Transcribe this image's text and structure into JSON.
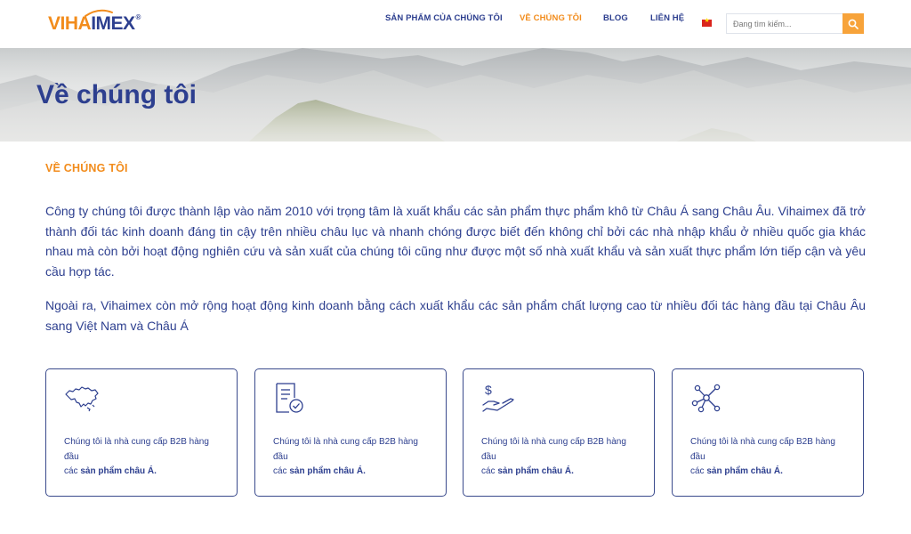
{
  "header": {
    "logo": {
      "part1": "VIHA",
      "part2": "IMEX",
      "reg": "®"
    },
    "nav": [
      {
        "label": "SẢN PHẨM CỦA CHÚNG TÔI"
      },
      {
        "label": "VỀ CHÚNG TÔI",
        "active": true
      },
      {
        "label": "BLOG"
      },
      {
        "label": "LIÊN HỆ"
      }
    ],
    "flag": "vietnam-flag-icon",
    "search": {
      "placeholder": "Đang tìm kiếm...",
      "value": ""
    }
  },
  "banner": {
    "title": "Về chúng tôi"
  },
  "content": {
    "section_label": "VỀ CHÚNG TÔI",
    "paragraph1": "Công ty chúng tôi được thành lập vào năm 2010 với trọng tâm là xuất khẩu các sản phẩm thực phẩm khô từ Châu Á sang Châu Âu. Vihaimex đã trở thành đối tác kinh doanh đáng tin cậy trên nhiều châu lục và nhanh chóng được biết đến không chỉ bởi các nhà nhập khẩu ở nhiều quốc gia khác nhau mà còn bởi hoạt động nghiên cứu và sản xuất của chúng tôi cũng như được một số nhà xuất khẩu và sản xuất thực phẩm lớn tiếp cận và yêu cầu hợp tác.",
    "paragraph2": "Ngoài ra, Vihaimex còn mở rộng hoạt động kinh doanh bằng cách xuất khẩu các sản phẩm chất lượng cao từ nhiều đối tác hàng đầu tại Châu Âu sang Việt Nam và Châu Á"
  },
  "cards": [
    {
      "icon": "asia-map-icon",
      "line1": "Chúng tôi là nhà cung cấp B2B hàng đầu",
      "line2_prefix": "các ",
      "line2_bold": "sản phẩm châu Á."
    },
    {
      "icon": "document-check-icon",
      "line1": "Chúng tôi là nhà cung cấp B2B hàng đầu",
      "line2_prefix": "các ",
      "line2_bold": "sản phẩm châu Á."
    },
    {
      "icon": "hand-dollar-icon",
      "line1": "Chúng tôi là nhà cung cấp B2B hàng đầu",
      "line2_prefix": "các ",
      "line2_bold": "sản phẩm châu Á."
    },
    {
      "icon": "network-nodes-icon",
      "line1": "Chúng tôi là nhà cung cấp B2B hàng đầu",
      "line2_prefix": "các ",
      "line2_bold": "sản phẩm châu Á."
    }
  ],
  "colors": {
    "brand_blue": "#2d3f8f",
    "brand_orange": "#f28c1c",
    "search_button": "#f7a33a"
  }
}
